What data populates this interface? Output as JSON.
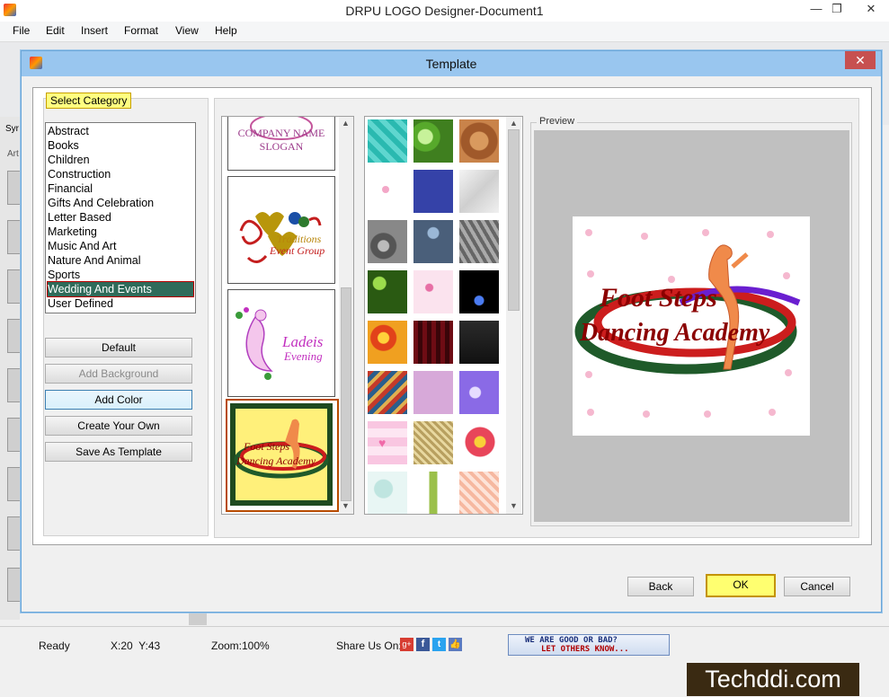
{
  "window": {
    "title": "DRPU LOGO Designer-Document1",
    "minimize": "—",
    "maximize": "❐",
    "close": "✕"
  },
  "menu": [
    "File",
    "Edit",
    "Insert",
    "Format",
    "View",
    "Help"
  ],
  "side_tabs": {
    "a": "Syr",
    "b": "Art"
  },
  "dialog": {
    "title": "Template",
    "close": "✕",
    "category_label": "Select Category",
    "categories": [
      "Abstract",
      "Books",
      "Children",
      "Construction",
      "Financial",
      "Gifts And Celebration",
      "Letter Based",
      "Marketing",
      "Music And Art",
      "Nature And Animal",
      "Sports",
      "Wedding And Events",
      "User Defined"
    ],
    "selected_category": "Wedding And Events",
    "buttons": {
      "default": "Default",
      "add_background": "Add Background",
      "add_color": "Add Color",
      "create_your_own": "Create Your Own",
      "save_as_template": "Save As Template"
    },
    "templates": {
      "t1": {
        "line1": "COMPANY NAME",
        "line2": "SLOGAN"
      },
      "t2": {
        "line1": "Traditions",
        "line2": "Event Group"
      },
      "t3": {
        "line1": "Ladeis",
        "line2": "Evening"
      },
      "t4": {
        "line1": "Foot Steps",
        "line2": "Dancing Academy"
      }
    },
    "preview_label": "Preview",
    "preview": {
      "line1": "Foot Steps",
      "line2": "Dancing Academy"
    },
    "footer": {
      "back": "Back",
      "ok": "OK",
      "cancel": "Cancel"
    }
  },
  "status": {
    "ready": "Ready",
    "coords": "X:20  Y:43",
    "zoom": "Zoom:100%",
    "share": "Share Us On:",
    "feedback_line1": "WE ARE GOOD OR BAD?",
    "feedback_line2": "LET OTHERS KNOW..."
  },
  "watermark": "Techddi.com",
  "colors": {
    "accent": "#99c6ef",
    "selected": "#2f6b5a",
    "highlight": "#ffff80",
    "logo_red": "#8b0000"
  }
}
